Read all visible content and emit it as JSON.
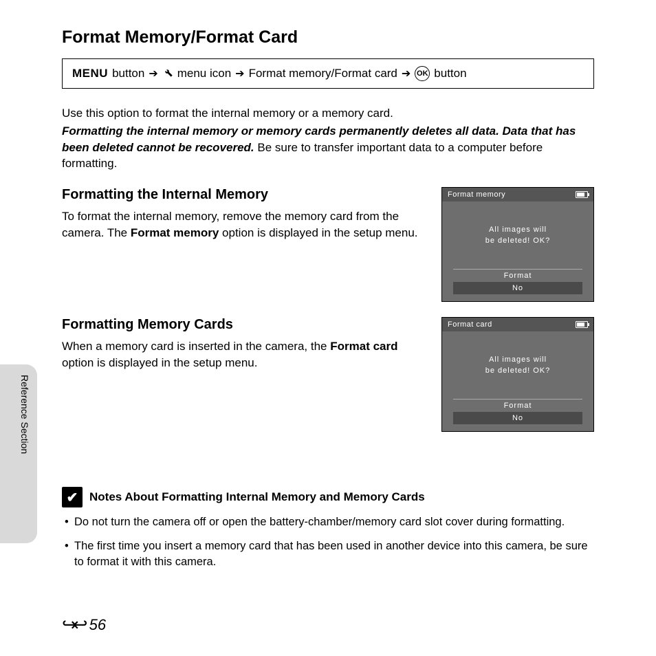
{
  "title": "Format Memory/Format Card",
  "nav": {
    "menu": "MENU",
    "button1": "button",
    "path": "menu icon",
    "item": "Format memory/Format card",
    "ok_button": "button",
    "ok": "OK"
  },
  "intro": "Use this option to format the internal memory or a memory card.",
  "warning_bold": "Formatting the internal memory or memory cards permanently deletes all data. Data that has been deleted cannot be recovered.",
  "warning_rest": " Be sure to transfer important data to a computer before formatting.",
  "section1": {
    "heading": "Formatting the Internal Memory",
    "text_a": "To format the internal memory, remove the memory card from the camera. The ",
    "text_bold": "Format memory",
    "text_b": " option is displayed in the setup menu."
  },
  "lcd1": {
    "title": "Format memory",
    "line1": "All images will",
    "line2": "be deleted! OK?",
    "opt1": "Format",
    "opt2": "No"
  },
  "section2": {
    "heading": "Formatting Memory Cards",
    "text_a": "When a memory card is inserted in the camera, the ",
    "text_bold": "Format card",
    "text_b": " option is displayed in the setup menu."
  },
  "lcd2": {
    "title": "Format card",
    "line1": "All images will",
    "line2": "be deleted! OK?",
    "opt1": "Format",
    "opt2": "No"
  },
  "sidebar": "Reference Section",
  "notes": {
    "heading": "Notes About Formatting Internal Memory and Memory Cards",
    "items": [
      "Do not turn the camera off or open the battery-chamber/memory card slot cover during formatting.",
      "The first time you insert a memory card that has been used in another device into this camera, be sure to format it with this camera."
    ]
  },
  "page": "56"
}
